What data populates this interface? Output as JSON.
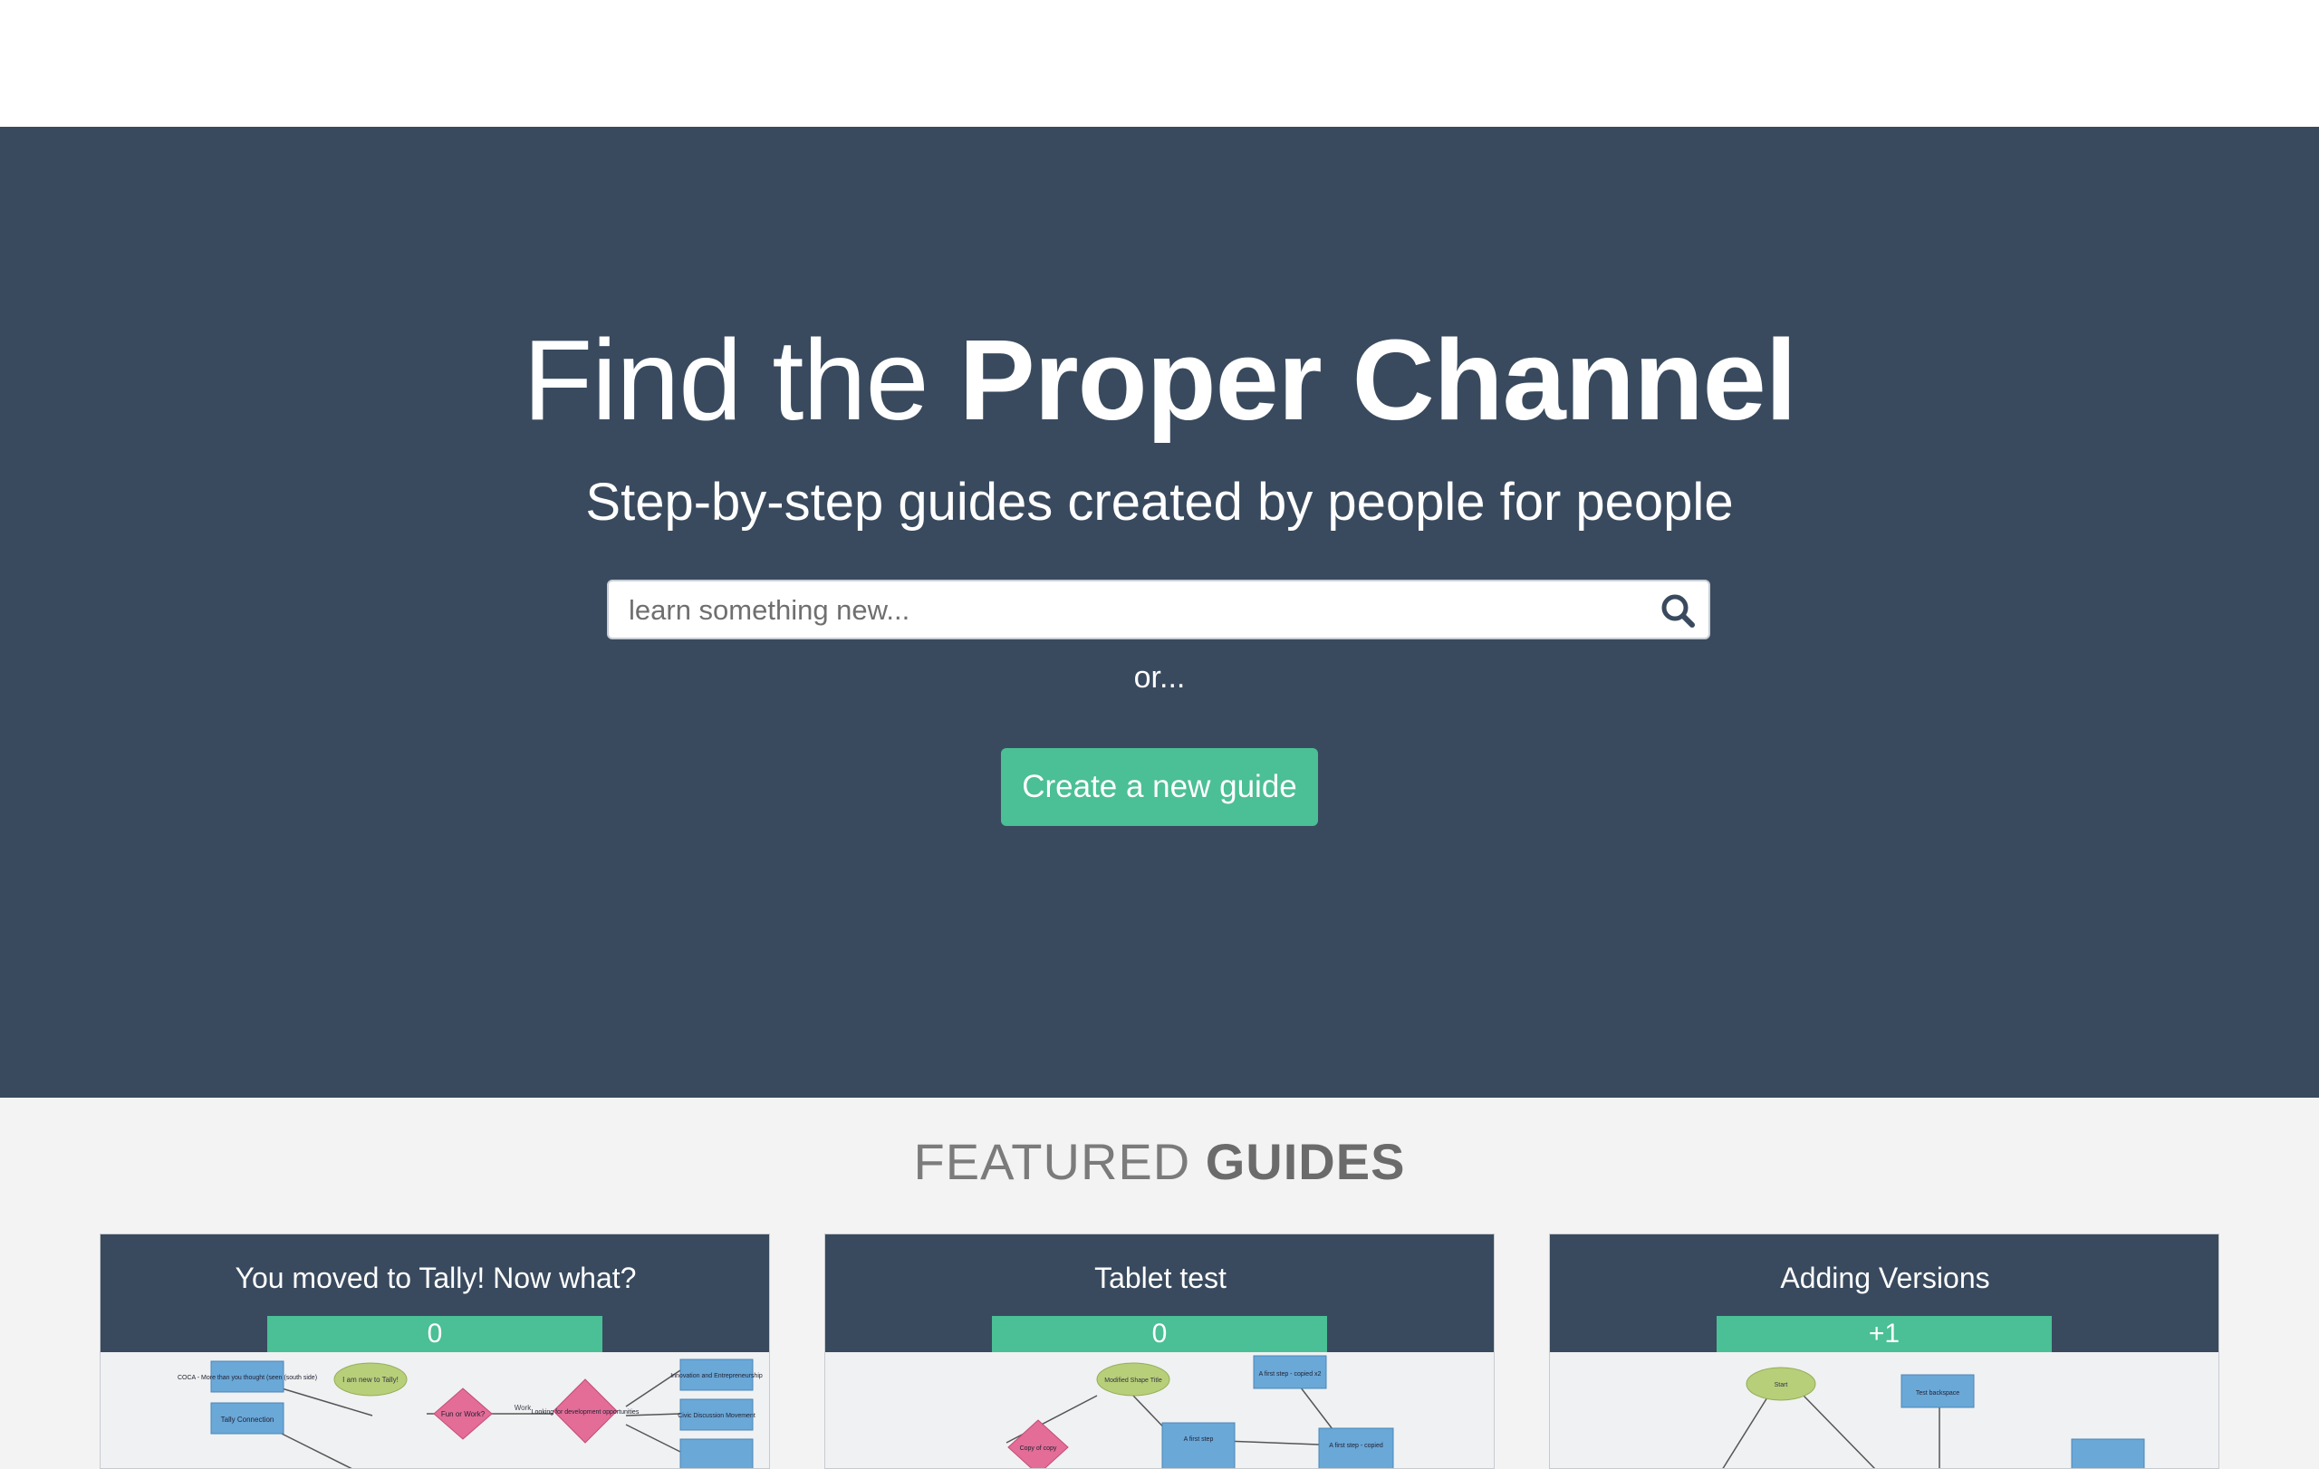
{
  "hero": {
    "title_light": "Find the",
    "title_bold": "Proper Channel",
    "subtitle": "Step-by-step guides created by people for people",
    "search_placeholder": "learn something new...",
    "or_text": "or...",
    "create_button": "Create a new guide"
  },
  "featured": {
    "title_light": "FEATURED",
    "title_bold": "GUIDES"
  },
  "guides": [
    {
      "title": "You moved to Tally! Now what?",
      "votes": "0",
      "nodes": [
        "COCA - More than you thought (seen (south side)",
        "Tally Connection",
        "I am new to Tally!",
        "Fun or Work?",
        "Looking for development opportunities",
        "Innovation and Entrepreneurship",
        "Civic Discussion Movement",
        "Work"
      ]
    },
    {
      "title": "Tablet test",
      "votes": "0",
      "nodes": [
        "Modified Shape Title",
        "A first step - copied x2",
        "A first step",
        "A first step - copied",
        "Copy of copy"
      ]
    },
    {
      "title": "Adding Versions",
      "votes": "+1",
      "nodes": [
        "Start",
        "Test backspace"
      ]
    }
  ],
  "colors": {
    "hero_bg": "#394a5e",
    "accent": "#4bbf95",
    "page_bg": "#f3f3f3"
  }
}
